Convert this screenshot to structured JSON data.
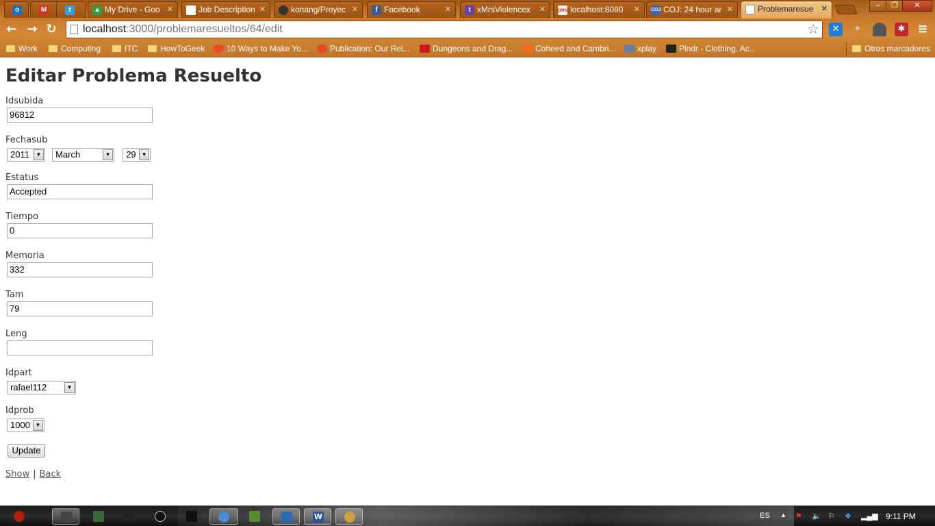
{
  "browser": {
    "tabs": [
      {
        "label": "",
        "icon": "outlook-icon",
        "color": "#1e6fc4"
      },
      {
        "label": "",
        "icon": "gmail-icon",
        "color": "#d93025"
      },
      {
        "label": "",
        "icon": "twitter-icon",
        "color": "#2ea1de"
      },
      {
        "label": "My Drive - Goo",
        "icon": "drive-icon",
        "color": "#2f9e44"
      },
      {
        "label": "Job Description",
        "icon": "page-icon",
        "color": "#ffffff"
      },
      {
        "label": "konang/Proyec",
        "icon": "github-icon",
        "color": "#333333"
      },
      {
        "label": "Facebook",
        "icon": "facebook-icon",
        "color": "#3b5998"
      },
      {
        "label": "xMrsViolencex",
        "icon": "twitch-icon",
        "color": "#6441a5"
      },
      {
        "label": "localhost:8080",
        "icon": "pma-icon",
        "color": "#f3f3f3"
      },
      {
        "label": "COJ: 24 hour ar",
        "icon": "coj-icon",
        "color": "#3a66b0"
      },
      {
        "label": "Problemaresue",
        "icon": "page-icon",
        "color": "#ffffff"
      }
    ],
    "url_host": "localhost",
    "url_path": ":3000/problemaresueltos/64/edit",
    "bookmarks": [
      {
        "label": "Work",
        "icon": "folder-icon"
      },
      {
        "label": "Computing",
        "icon": "folder-icon"
      },
      {
        "label": "ITC",
        "icon": "folder-icon"
      },
      {
        "label": "HowToGeek",
        "icon": "folder-icon"
      },
      {
        "label": "10 Ways to Make Yo...",
        "icon": "stumbleupon-icon"
      },
      {
        "label": "Publication: Our Rel...",
        "icon": "stumbleupon-icon"
      },
      {
        "label": "Dungeons and Drag...",
        "icon": "youtube-icon"
      },
      {
        "label": "Coheed and Cambri...",
        "icon": "mixcloud-icon"
      },
      {
        "label": "xplay",
        "icon": "tv-icon"
      },
      {
        "label": "Plndr - Clothing. Ac...",
        "icon": "plndr-icon"
      }
    ],
    "other_bookmarks": "Otros marcadores"
  },
  "page": {
    "title": "Editar Problema Resuelto",
    "fields": {
      "idsubida": {
        "label": "Idsubida",
        "value": "96812"
      },
      "fechasub": {
        "label": "Fechasub",
        "year": "2011",
        "month": "March",
        "day": "29"
      },
      "estatus": {
        "label": "Estatus",
        "value": "Accepted"
      },
      "tiempo": {
        "label": "Tiempo",
        "value": "0"
      },
      "memoria": {
        "label": "Memoria",
        "value": "332"
      },
      "tam": {
        "label": "Tam",
        "value": "79"
      },
      "leng": {
        "label": "Leng",
        "value": ""
      },
      "idpart": {
        "label": "Idpart",
        "value": "rafael112"
      },
      "idprob": {
        "label": "Idprob",
        "value": "1000"
      }
    },
    "submit_label": "Update",
    "links": {
      "show": "Show",
      "separator": "|",
      "back": "Back"
    }
  },
  "taskbar": {
    "language": "ES",
    "clock": "9:11 PM"
  },
  "colors": {
    "chrome_theme": "#c97a2c",
    "heading": "#333333"
  }
}
